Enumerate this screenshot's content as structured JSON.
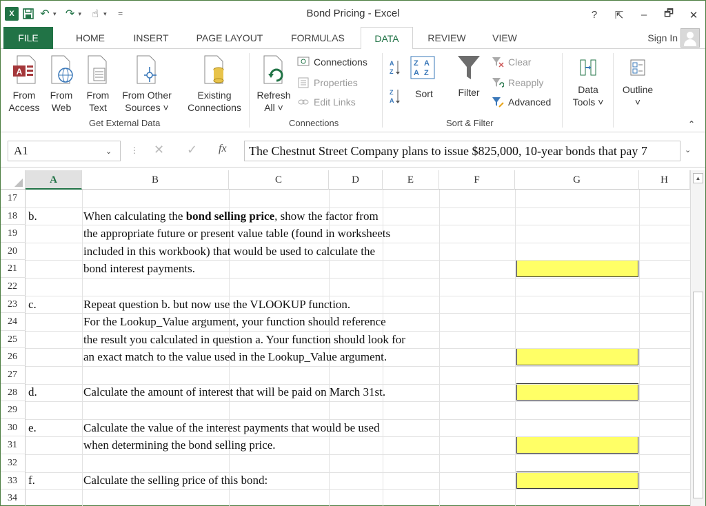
{
  "window": {
    "title": "Bond Pricing - Excel",
    "controls": {
      "help": "?",
      "ribbon_display": "⇱",
      "minimize": "–",
      "restore": "🗗",
      "close": "✕"
    }
  },
  "qat": {
    "app_icon": "X",
    "save": "🖫",
    "undo": "↶",
    "redo": "↷",
    "touch": "☝",
    "customize": "="
  },
  "tabs": [
    {
      "label": "FILE"
    },
    {
      "label": "HOME"
    },
    {
      "label": "INSERT"
    },
    {
      "label": "PAGE LAYOUT"
    },
    {
      "label": "FORMULAS"
    },
    {
      "label": "DATA"
    },
    {
      "label": "REVIEW"
    },
    {
      "label": "VIEW"
    }
  ],
  "active_tab": "DATA",
  "sign_in": "Sign In",
  "ribbon": {
    "get_external_data": {
      "label": "Get External Data",
      "buttons": [
        {
          "line1": "From",
          "line2": "Access"
        },
        {
          "line1": "From",
          "line2": "Web"
        },
        {
          "line1": "From",
          "line2": "Text"
        },
        {
          "line1": "From Other",
          "line2": "Sources ˅"
        },
        {
          "line1": "Existing",
          "line2": "Connections"
        }
      ]
    },
    "connections": {
      "label": "Connections",
      "refresh": {
        "line1": "Refresh",
        "line2": "All ˅"
      },
      "items": [
        "Connections",
        "Properties",
        "Edit Links"
      ]
    },
    "sort_filter": {
      "label": "Sort & Filter",
      "sort": "Sort",
      "filter": "Filter",
      "clear": "Clear",
      "reapply": "Reapply",
      "advanced": "Advanced"
    },
    "data_tools": {
      "line1": "Data",
      "line2": "Tools ˅"
    },
    "outline": {
      "line1": "Outline",
      "line2": "˅"
    }
  },
  "formula_bar": {
    "name_box": "A1",
    "content": "The Chestnut Street Company plans to issue $825,000, 10-year bonds that pay 7"
  },
  "columns": [
    "A",
    "B",
    "C",
    "D",
    "E",
    "F",
    "G",
    "H"
  ],
  "rows": [
    "17",
    "18",
    "19",
    "20",
    "21",
    "22",
    "23",
    "24",
    "25",
    "26",
    "27",
    "28",
    "29",
    "30",
    "31",
    "32",
    "33",
    "34"
  ],
  "cells": {
    "r18a": "b.",
    "r18b_pre": "When calculating the ",
    "r18b_bold": "bond selling price",
    "r18b_post": ", show the factor from",
    "r19b": "the appropriate future or present value table (found in worksheets",
    "r20b": "included in this workbook) that would be used to calculate the",
    "r21b": "bond interest payments.",
    "r23a": "c.",
    "r23b": "Repeat question b. but now use the VLOOKUP function.",
    "r24b": "For the Lookup_Value argument, your function should reference",
    "r25b": "the result you calculated in question a.   Your function should look for",
    "r26b": "an exact match to the value used in the Lookup_Value argument.",
    "r28a": "d.",
    "r28b": "Calculate the amount of interest that will be paid on March 31st.",
    "r30a": "e.",
    "r30b": "Calculate the value of the interest payments that would be used",
    "r31b": "when determining the bond selling price.",
    "r33a": "f.",
    "r33b": "Calculate the selling price of this bond:"
  },
  "colors": {
    "excel_green": "#217346",
    "answer_fill": "#ffff66"
  }
}
